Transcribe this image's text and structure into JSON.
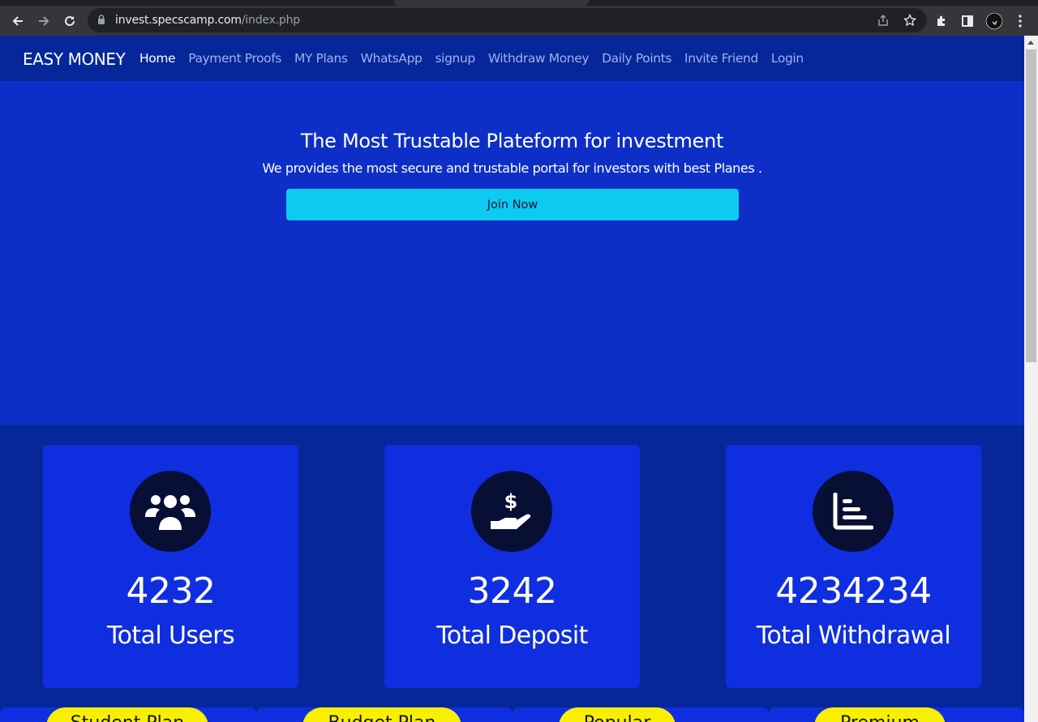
{
  "browser": {
    "url_domain": "invest.specscamp.com",
    "url_path": "/index.php",
    "icons": [
      "back-icon",
      "forward-icon",
      "reload-icon",
      "lock-icon",
      "share-icon",
      "bookmark-star-icon",
      "extensions-icon",
      "side-panel-icon",
      "profile-avatar",
      "menu-icon"
    ]
  },
  "navbar": {
    "brand": "EASY MONEY",
    "links": [
      {
        "label": "Home",
        "active": true
      },
      {
        "label": "Payment Proofs"
      },
      {
        "label": "MY Plans"
      },
      {
        "label": "WhatsApp"
      },
      {
        "label": "signup"
      },
      {
        "label": "Withdraw Money"
      },
      {
        "label": "Daily Points"
      },
      {
        "label": "Invite Friend"
      },
      {
        "label": "Login"
      }
    ]
  },
  "hero": {
    "title": "The Most Trustable Plateform for investment",
    "subtitle": "We provides the most secure and trustable portal for investors with best Planes .",
    "cta": "Join Now"
  },
  "stats": [
    {
      "icon": "users-icon",
      "value": "4232",
      "label": "Total Users"
    },
    {
      "icon": "hand-dollar-icon",
      "value": "3242",
      "label": "Total Deposit"
    },
    {
      "icon": "bar-chart-icon",
      "value": "4234234",
      "label": "Total Withdrawal"
    }
  ],
  "plans": [
    {
      "label": "Student Plan"
    },
    {
      "label": "Budget Plan"
    },
    {
      "label": "Popular"
    },
    {
      "label": "Premium"
    }
  ],
  "colors": {
    "navbar": "#06279a",
    "hero": "#0d2fc7",
    "card": "#0f2ee0",
    "icon_circle": "#070f35",
    "button": "#0dcaf0",
    "plan_tag": "#f8f000"
  }
}
